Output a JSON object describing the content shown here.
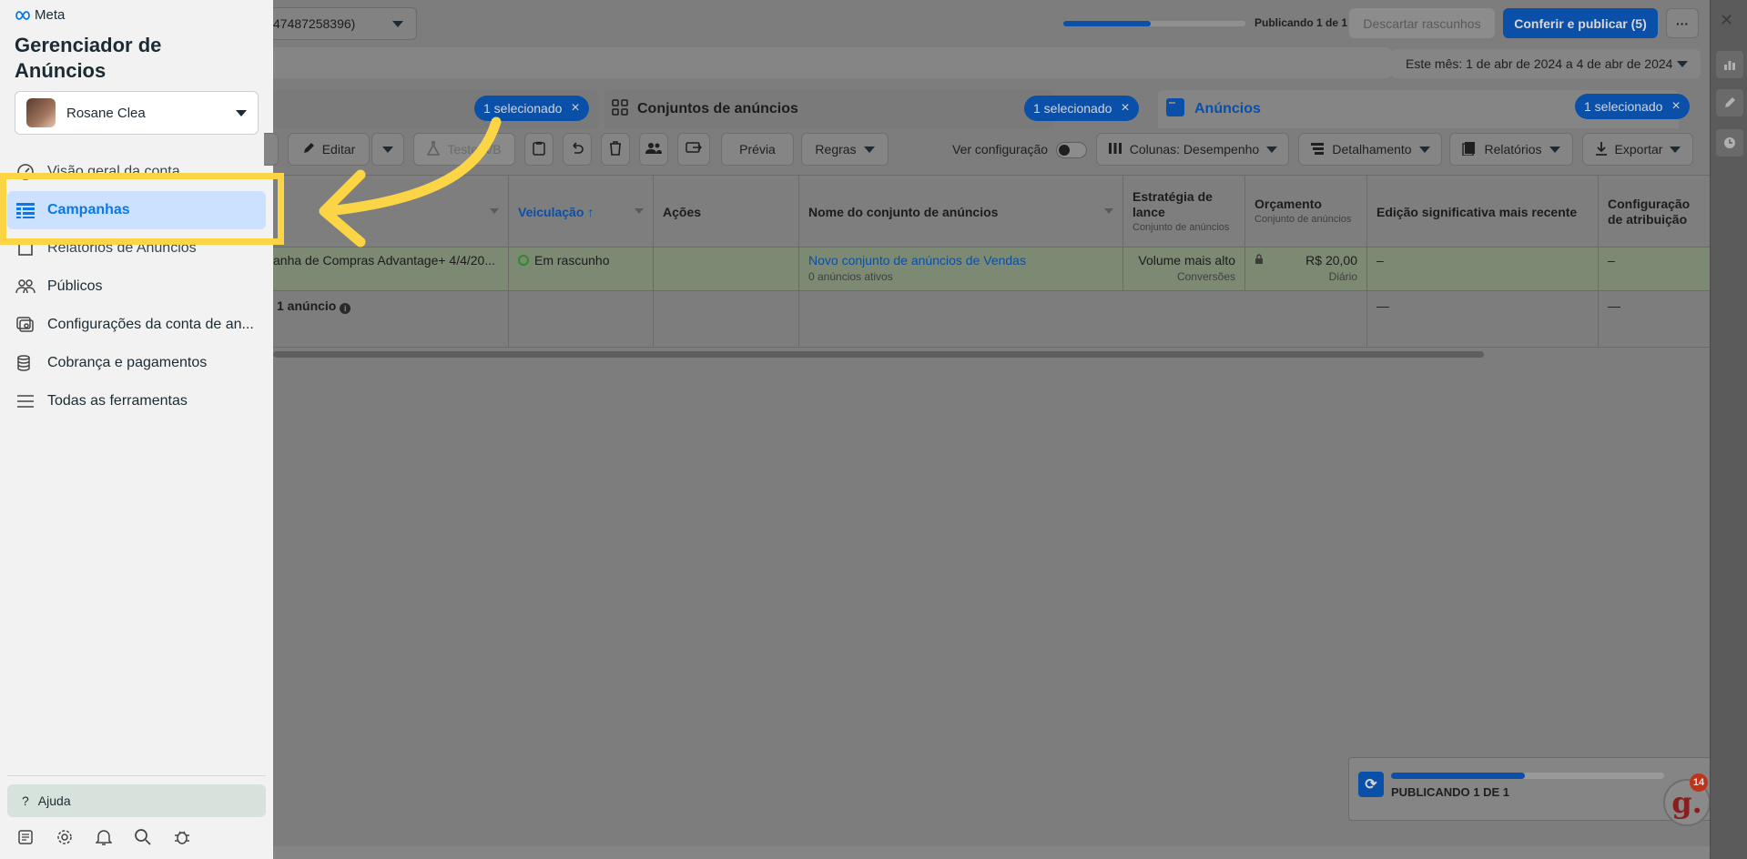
{
  "sidebar": {
    "brand": "Meta",
    "app_title": "Gerenciador de Anúncios",
    "account_name": "Rosane Clea",
    "items": [
      {
        "label": "Visão geral da conta",
        "icon": "gauge-icon"
      },
      {
        "label": "Campanhas",
        "icon": "table-icon"
      },
      {
        "label": "Relatórios de Anúncios",
        "icon": "report-icon"
      },
      {
        "label": "Públicos",
        "icon": "people-icon"
      },
      {
        "label": "Configurações da conta de an...",
        "icon": "settings-stack-icon"
      },
      {
        "label": "Cobrança e pagamentos",
        "icon": "coins-icon"
      },
      {
        "label": "Todas as ferramentas",
        "icon": "menu-icon"
      }
    ],
    "help_label": "Ajuda",
    "footer_icons": [
      "news-icon",
      "gear-icon",
      "bell-icon",
      "search-icon",
      "bug-icon"
    ]
  },
  "header": {
    "account_select_text": "47487258396)",
    "publishing_status": "Publicando 1 de 1",
    "publishing_progress": 0.48,
    "discard_label": "Descartar rascunhos",
    "publish_label": "Conferir e publicar (5)",
    "more_label": "···",
    "date_range": "Este mês: 1 de abr de 2024 a 4 de abr de 2024"
  },
  "tabs": [
    {
      "label": "",
      "selected": "1 selecionado"
    },
    {
      "label": "Conjuntos de anúncios",
      "selected": "1 selecionado"
    },
    {
      "label": "Anúncios",
      "selected": "1 selecionado"
    }
  ],
  "toolbar": {
    "edit_label": "Editar",
    "ab_test_label": "Teste A/B",
    "preview_label": "Prévia",
    "rules_label": "Regras",
    "view_config_label": "Ver configuração",
    "columns_label": "Colunas: Desempenho",
    "breakdown_label": "Detalhamento",
    "reports_label": "Relatórios",
    "export_label": "Exportar"
  },
  "table": {
    "headers": {
      "delivery": "Veiculação ↑",
      "actions": "Ações",
      "adset_name": "Nome do conjunto de anúncios",
      "bid_strategy": "Estratégia de lance",
      "bid_strategy_sub": "Conjunto de anúncios",
      "budget": "Orçamento",
      "budget_sub": "Conjunto de anúncios",
      "last_edit": "Edição significativa mais recente",
      "attribution": "Configuração de atribuição"
    },
    "rows": [
      {
        "campaign": "anha de Compras Advantage+ 4/4/20...",
        "delivery": "Em rascunho",
        "adset_name": "Novo conjunto de anúncios de Vendas",
        "adset_sub": "0 anúncios ativos",
        "bid_strategy": "Volume mais alto",
        "bid_strategy_sub": "Conversões",
        "budget": "R$ 20,00",
        "budget_sub": "Diário",
        "last_edit": "–",
        "attribution": "–"
      }
    ],
    "summary": {
      "label": "1 anúncio",
      "last_edit": "—",
      "attribution": "—"
    }
  },
  "toast": {
    "text": "PUBLICANDO 1 DE 1",
    "progress": 0.49
  },
  "badge": {
    "letter": "g.",
    "count": "14"
  },
  "colors": {
    "accent": "#0a78e6",
    "highlight": "#fbd545",
    "active_nav_bg": "#cce0ff"
  }
}
